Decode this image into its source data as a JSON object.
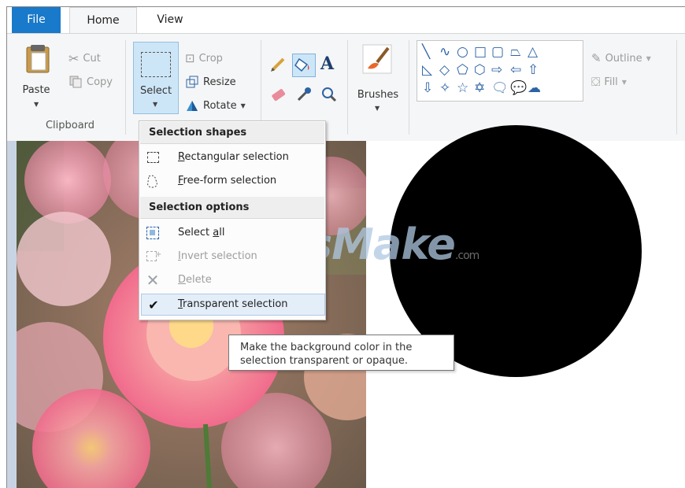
{
  "tabs": {
    "file": "File",
    "home": "Home",
    "view": "View"
  },
  "clipboard": {
    "paste": "Paste",
    "cut": "Cut",
    "copy": "Copy",
    "group_label": "Clipboard"
  },
  "image": {
    "select": "Select",
    "crop": "Crop",
    "resize": "Resize",
    "rotate": "Rotate"
  },
  "brushes": {
    "label": "Brushes"
  },
  "shapes": {
    "outline": "Outline",
    "fill": "Fill"
  },
  "select_menu": {
    "header_shapes": "Selection shapes",
    "rectangular": "Rectangular selection",
    "rectangular_key": "R",
    "rectangular_rest": "ectangular selection",
    "freeform_key": "F",
    "freeform_rest": "ree-form selection",
    "header_options": "Selection options",
    "select_all_pre": "Select ",
    "select_all_key": "a",
    "select_all_rest": "ll",
    "invert_key": "I",
    "invert_rest": "nvert selection",
    "delete_key": "D",
    "delete_rest": "elete",
    "transparent_key": "T",
    "transparent_rest": "ransparent selection"
  },
  "tooltip": {
    "line1": "Make the background color in the",
    "line2": "selection transparent or opaque."
  },
  "watermark": {
    "text": "TipsMake",
    "suffix": ".com"
  },
  "colors": {
    "accent": "#1979ca",
    "ribbon_bg": "#f5f6f7",
    "shape_stroke": "#2d63a5",
    "selected_bg": "#cde6f7"
  }
}
